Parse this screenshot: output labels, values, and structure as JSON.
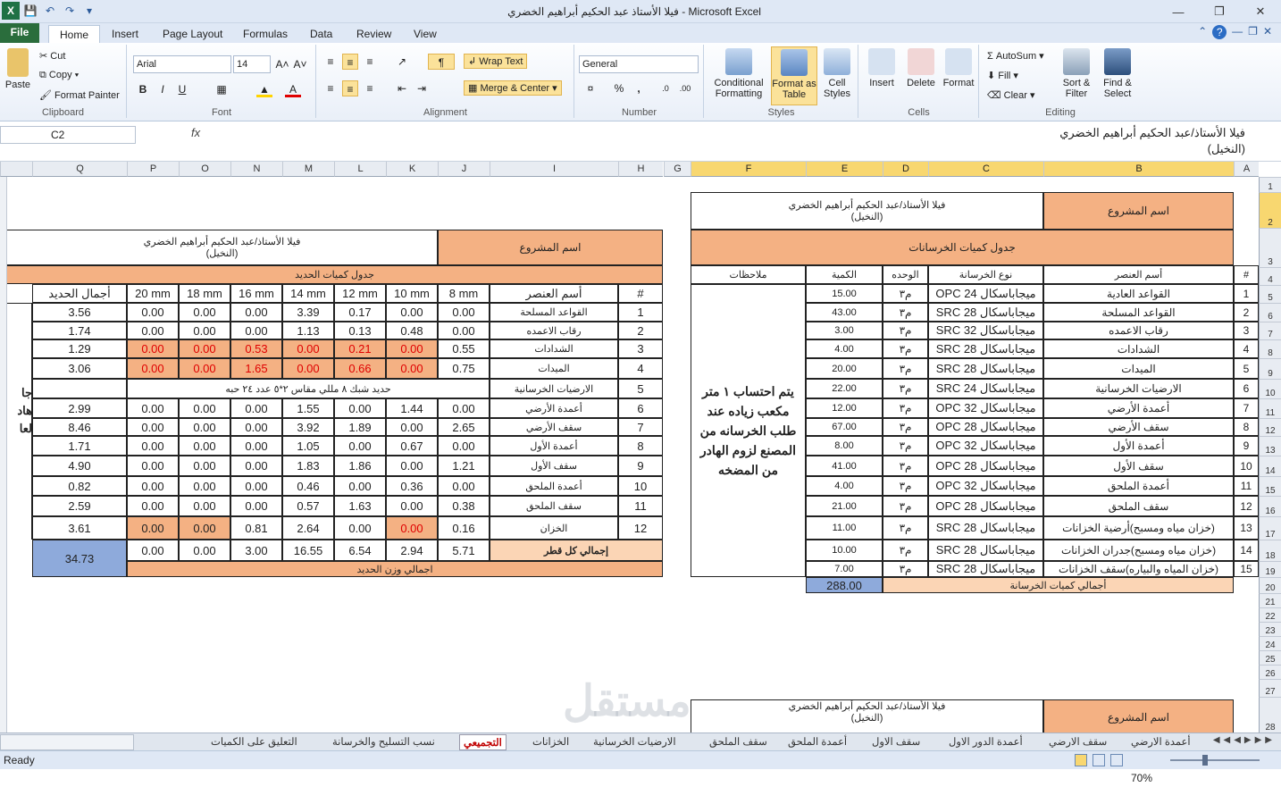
{
  "app": {
    "title": "فيلا الأستاذ عبد الحكيم أبراهيم الخضري  -  Microsoft Excel",
    "status": "Ready",
    "zoom": "70%"
  },
  "tabs": [
    "File",
    "Home",
    "Insert",
    "Page Layout",
    "Formulas",
    "Data",
    "Review",
    "View"
  ],
  "ribbon": {
    "paste": "Paste",
    "cut": "Cut",
    "copy": "Copy",
    "format_painter": "Format Painter",
    "clipboard": "Clipboard",
    "font_name": "Arial",
    "font_size": "14",
    "font": "Font",
    "bold": "B",
    "italic": "I",
    "underline": "U",
    "alignment": "Alignment",
    "wrap_text": "Wrap Text",
    "merge_center": "Merge & Center",
    "number_format": "General",
    "number": "Number",
    "cond_format": "Conditional Formatting",
    "format_table": "Format as Table",
    "cell_styles": "Cell Styles",
    "styles": "Styles",
    "insert": "Insert",
    "delete": "Delete",
    "format": "Format",
    "cells": "Cells",
    "autosum": "AutoSum",
    "fill": "Fill",
    "clear": "Clear",
    "sort_filter": "Sort & Filter",
    "find_select": "Find & Select",
    "editing": "Editing"
  },
  "formula": {
    "name_box": "C2",
    "fx": "fx",
    "line1": "فيلا الأستاذ/عبد الحكيم أبراهيم الخضري",
    "line2": "(النخيل)"
  },
  "columns_right": [
    "A",
    "B",
    "C",
    "D",
    "E",
    "F",
    "G"
  ],
  "columns_left": [
    "H",
    "I",
    "J",
    "K",
    "L",
    "M",
    "N",
    "O",
    "P",
    "Q"
  ],
  "rows": [
    "1",
    "2",
    "3",
    "4",
    "5",
    "6",
    "7",
    "8",
    "9",
    "10",
    "11",
    "12",
    "13",
    "14",
    "15",
    "16",
    "17",
    "18",
    "19",
    "20",
    "21",
    "22",
    "23",
    "24",
    "25",
    "26",
    "27",
    "28"
  ],
  "concrete": {
    "project_label": "اسم المشروع",
    "project_name": "فيلا الأستاذ/عبد الحكيم أبراهيم الخضري",
    "project_sub": "(النخيل)",
    "table_title": "جدول كميات الخرسانات",
    "headers": [
      "#",
      "أسم العنصر",
      "نوع الخرسانة",
      "الوحده",
      "الكمية",
      "ملاحظات"
    ],
    "rows": [
      [
        "1",
        "القواعد العادية",
        "OPC ميجاباسكال 24",
        "م٣",
        "15.00"
      ],
      [
        "2",
        "القواعد المسلحة",
        "SRC ميجاباسكال 28",
        "م٣",
        "43.00"
      ],
      [
        "3",
        "رقاب الاعمده",
        "SRC ميجاباسكال 32",
        "م٣",
        "3.00"
      ],
      [
        "4",
        "الشدادات",
        "SRC ميجاباسكال 28",
        "م٣",
        "4.00"
      ],
      [
        "5",
        "الميدات",
        "SRC ميجاباسكال 28",
        "م٣",
        "20.00"
      ],
      [
        "6",
        "الارضيات الخرسانية",
        "SRC ميجاباسكال 24",
        "م٣",
        "22.00"
      ],
      [
        "7",
        "أعمدة الأرضي",
        "OPC ميجاباسكال 32",
        "م٣",
        "12.00"
      ],
      [
        "8",
        "سقف الأرضي",
        "OPC ميجاباسكال 28",
        "م٣",
        "67.00"
      ],
      [
        "9",
        "أعمدة الأول",
        "OPC ميجاباسكال 32",
        "م٣",
        "8.00"
      ],
      [
        "10",
        "سقف الأول",
        "OPC ميجاباسكال 28",
        "م٣",
        "41.00"
      ],
      [
        "11",
        "أعمدة الملحق",
        "OPC ميجاباسكال 32",
        "م٣",
        "4.00"
      ],
      [
        "12",
        "سقف الملحق",
        "OPC ميجاباسكال 28",
        "م٣",
        "21.00"
      ],
      [
        "13",
        "(خزان مياه ومسبح)أرضية الخزانات",
        "SRC ميجاباسكال 28",
        "م٣",
        "11.00"
      ],
      [
        "14",
        "(خزان مياه ومسبح)جدران الخزانات",
        "SRC ميجاباسكال 28",
        "م٣",
        "10.00"
      ],
      [
        "15",
        "(خزان المياه والبياره)سقف الخزانات",
        "SRC ميجاباسكال 28",
        "م٣",
        "7.00"
      ]
    ],
    "note": "يتم احتساب ١ متر مكعب زياده عند طلب الخرسانه من المصنع لزوم الهادر من المضخه",
    "total_label": "أجمالي كميات الخرسانة",
    "total": "288.00"
  },
  "steel": {
    "project_label": "اسم المشروع",
    "project_name": "فيلا الأستاذ/عبد الحكيم أبراهيم الخضري",
    "project_sub": "(النخيل)",
    "table_title": "جدول كميات الحديد",
    "headers": [
      "#",
      "أسم العنصر",
      "8 mm",
      "10 mm",
      "12 mm",
      "14 mm",
      "16 mm",
      "18 mm",
      "20 mm",
      "أجمال الحديد"
    ],
    "rows": [
      [
        "1",
        "القواعد المسلحة",
        "0.00",
        "0.00",
        "0.17",
        "3.39",
        "0.00",
        "0.00",
        "0.00",
        "3.56"
      ],
      [
        "2",
        "رقاب الاعمده",
        "0.00",
        "0.48",
        "0.13",
        "1.13",
        "0.00",
        "0.00",
        "0.00",
        "1.74"
      ],
      [
        "3",
        "الشدادات",
        "0.55",
        "0.00",
        "0.21",
        "0.00",
        "0.53",
        "0.00",
        "0.00",
        "1.29"
      ],
      [
        "4",
        "الميدات",
        "0.75",
        "0.00",
        "0.66",
        "0.00",
        "1.65",
        "0.00",
        "0.00",
        "3.06"
      ],
      [
        "6",
        "أعمدة الأرضي",
        "0.00",
        "1.44",
        "0.00",
        "1.55",
        "0.00",
        "0.00",
        "0.00",
        "2.99"
      ],
      [
        "7",
        "سقف الأرضي",
        "2.65",
        "0.00",
        "1.89",
        "3.92",
        "0.00",
        "0.00",
        "0.00",
        "8.46"
      ],
      [
        "8",
        "أعمدة الأول",
        "0.00",
        "0.67",
        "0.00",
        "1.05",
        "0.00",
        "0.00",
        "0.00",
        "1.71"
      ],
      [
        "9",
        "سقف الأول",
        "1.21",
        "0.00",
        "1.86",
        "1.83",
        "0.00",
        "0.00",
        "0.00",
        "4.90"
      ],
      [
        "10",
        "أعمدة الملحق",
        "0.00",
        "0.36",
        "0.00",
        "0.46",
        "0.00",
        "0.00",
        "0.00",
        "0.82"
      ],
      [
        "11",
        "سقف الملحق",
        "0.38",
        "0.00",
        "1.63",
        "0.57",
        "0.00",
        "0.00",
        "0.00",
        "2.59"
      ],
      [
        "12",
        "الخزان",
        "0.16",
        "0.00",
        "0.00",
        "2.64",
        "0.81",
        "0.00",
        "0.00",
        "3.61"
      ]
    ],
    "row5_num": "5",
    "row5_name": "الارضيات الخرسانية",
    "row5_note": "حديد شبك ٨ مللي مقاس ٢*٥ عدد ٢٤ حبه",
    "total_label": "إجمالي كل قطر",
    "totals": [
      "5.71",
      "2.94",
      "6.54",
      "16.55",
      "3.00",
      "0.00",
      "0.00"
    ],
    "grand_label": "اجمالي وزن الحديد",
    "grand_total": "34.73",
    "side_text": "جا\nهاد\nلعا"
  },
  "sheet_tabs": [
    "أعمدة الارضي",
    "سقف الارضي",
    "أعمدة الدور الاول",
    "سقف الاول",
    "أعمدة الملحق",
    "سقف الملحق",
    "الارضيات الخرسانية",
    "الخزانات",
    "التجميعي",
    "نسب التسليح والخرسانة",
    "التعليق على الكميات"
  ],
  "watermark": "مستقل"
}
